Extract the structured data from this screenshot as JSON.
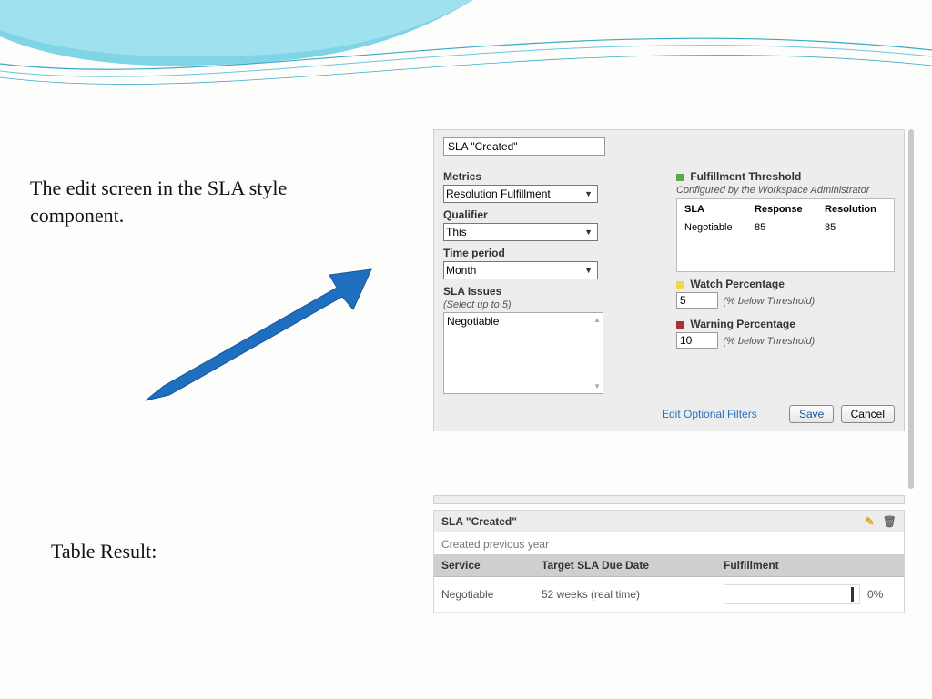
{
  "captions": {
    "edit_screen": "The edit screen in the SLA style component.",
    "table_result": "Table Result:"
  },
  "edit": {
    "title": "SLA \"Created\"",
    "metrics_label": "Metrics",
    "metrics_value": "Resolution Fulfillment",
    "qualifier_label": "Qualifier",
    "qualifier_value": "This",
    "time_label": "Time period",
    "time_value": "Month",
    "issues_label": "SLA Issues",
    "issues_hint": "(Select up to 5)",
    "issues_value": "Negotiable",
    "fulfillment_label": "Fulfillment Threshold",
    "fulfillment_hint": "Configured by the Workspace Administrator",
    "thresh": {
      "h_sla": "SLA",
      "h_resp": "Response",
      "h_reso": "Resolution",
      "row_sla": "Negotiable",
      "row_resp": "85",
      "row_reso": "85"
    },
    "watch_label": "Watch Percentage",
    "watch_value": "5",
    "watch_hint": "(% below Threshold)",
    "warn_label": "Warning Percentage",
    "warn_value": "10",
    "warn_hint": "(% below Threshold)",
    "filters_link": "Edit Optional Filters",
    "save": "Save",
    "cancel": "Cancel"
  },
  "result": {
    "title": "SLA \"Created\"",
    "subtitle": "Created previous year",
    "h_service": "Service",
    "h_target": "Target SLA Due Date",
    "h_fulfill": "Fulfillment",
    "row_service": "Negotiable",
    "row_target": "52 weeks (real time)",
    "row_fulfill": "0%"
  }
}
